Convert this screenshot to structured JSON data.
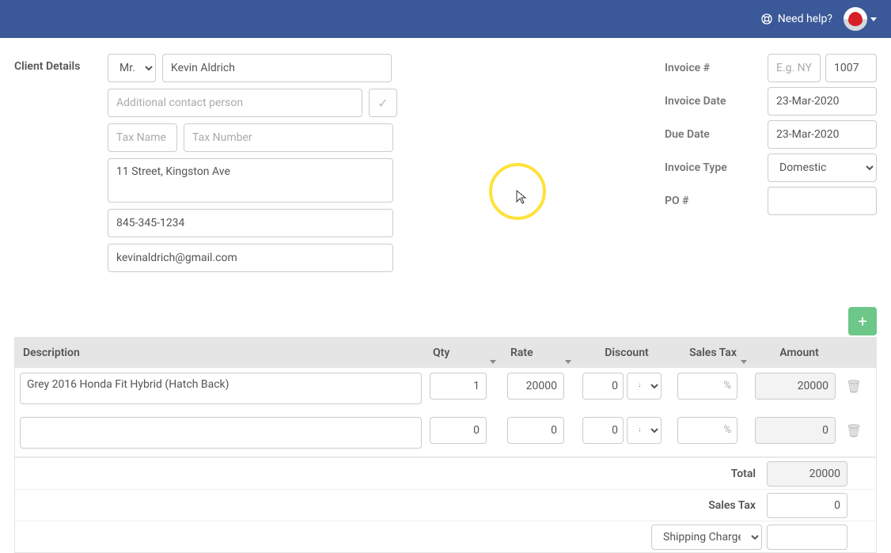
{
  "topbar": {
    "help_label": "Need help?"
  },
  "client": {
    "section_label": "Client Details",
    "salutation": "Mr.",
    "name": "Kevin Aldrich",
    "additional_contact_placeholder": "Additional contact person",
    "additional_contact": "",
    "tax_name_placeholder": "Tax Name",
    "tax_name": "",
    "tax_number_placeholder": "Tax Number",
    "tax_number": "",
    "address": "11 Street, Kingston Ave",
    "phone": "845-345-1234",
    "email": "kevinaldrich@gmail.com"
  },
  "invoice": {
    "labels": {
      "number": "Invoice #",
      "date": "Invoice Date",
      "due": "Due Date",
      "type": "Invoice Type",
      "po": "PO #"
    },
    "prefix_placeholder": "E.g. NYC",
    "prefix": "",
    "number": "1007",
    "date": "23-Mar-2020",
    "due": "23-Mar-2020",
    "type": "Domestic",
    "po": ""
  },
  "grid_headers": {
    "description": "Description",
    "qty": "Qty",
    "rate": "Rate",
    "discount": "Discount",
    "tax": "Sales Tax",
    "amount": "Amount"
  },
  "lines": [
    {
      "description": "Grey 2016 Honda Fit Hybrid (Hatch Back)",
      "qty": "1",
      "rate": "20000",
      "discount": "0",
      "discount_type": "#",
      "tax": "",
      "tax_unit": "%",
      "amount": "20000"
    },
    {
      "description": "",
      "qty": "0",
      "rate": "0",
      "discount": "0",
      "discount_type": "#",
      "tax": "",
      "tax_unit": "%",
      "amount": "0"
    }
  ],
  "totals": {
    "total_label": "Total",
    "total_value": "20000",
    "tax_label": "Sales Tax",
    "tax_value": "0",
    "shipping_label": "Shipping Charges",
    "shipping_value": ""
  },
  "icons": {
    "plus": "+",
    "check": "✓",
    "trash": "🗑"
  }
}
